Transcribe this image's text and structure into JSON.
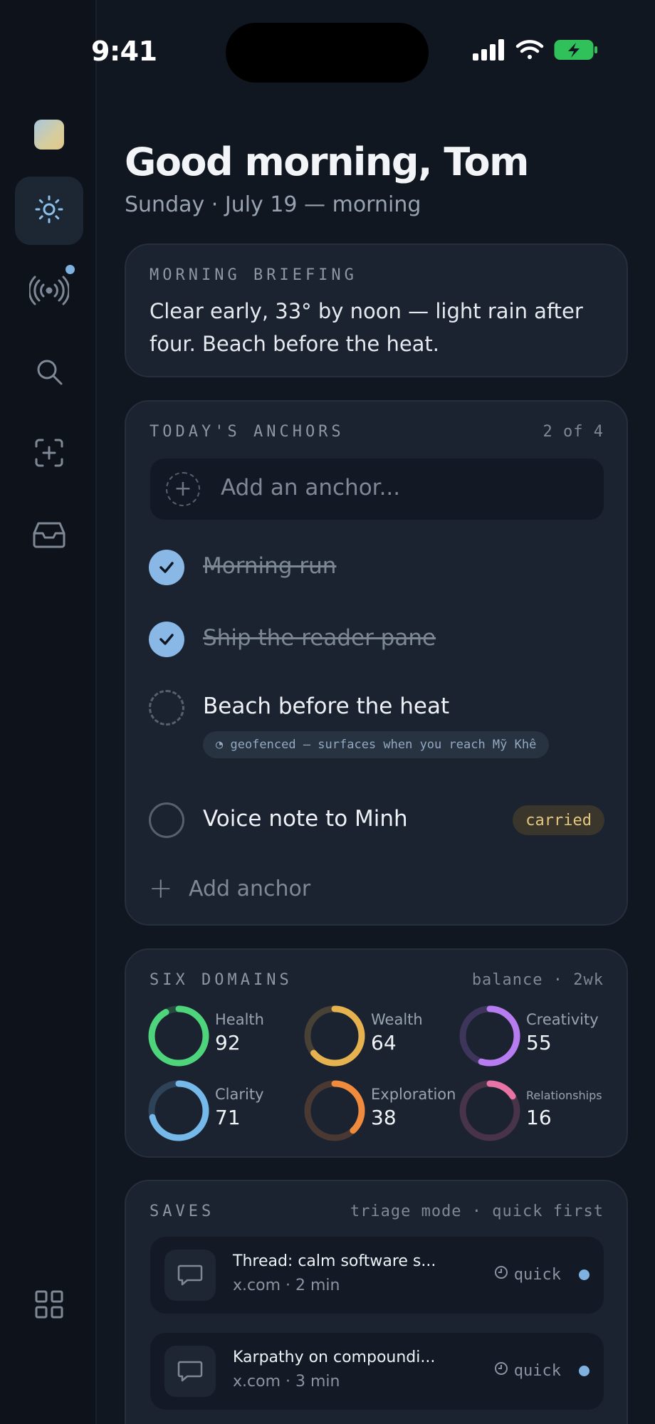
{
  "status": {
    "time": "9:41"
  },
  "header": {
    "greeting": "Good morning, Tom",
    "date": "Sunday · July 19 — morning"
  },
  "sidebar": {
    "items": [
      {
        "name": "today",
        "icon": "sun-icon",
        "active": true
      },
      {
        "name": "signals",
        "icon": "broadcast-icon",
        "badge": true
      },
      {
        "name": "search",
        "icon": "search-icon"
      },
      {
        "name": "capture",
        "icon": "add-frame-icon"
      },
      {
        "name": "inbox",
        "icon": "inbox-icon"
      },
      {
        "name": "apps",
        "icon": "grid-icon"
      }
    ]
  },
  "briefing": {
    "label": "MORNING BRIEFING",
    "text": "Clear early, 33° by noon — light rain after four. Beach before the heat."
  },
  "anchors": {
    "label": "TODAY'S ANCHORS",
    "count": "2 of 4",
    "input_placeholder": "Add an anchor...",
    "items": [
      {
        "text": "Morning run",
        "state": "done"
      },
      {
        "text": "Ship the reader pane",
        "state": "done"
      },
      {
        "text": "Beach before the heat",
        "state": "pending",
        "tag": "◔ geofenced — surfaces when you reach Mỹ Khê"
      },
      {
        "text": "Voice note to Minh",
        "state": "open",
        "badge": "carried"
      }
    ],
    "add_label": "Add anchor"
  },
  "domains": {
    "label": "SIX DOMAINS",
    "meta": "balance · 2wk",
    "items": [
      {
        "name": "Health",
        "value": 92,
        "color": "#4ed47a"
      },
      {
        "name": "Wealth",
        "value": 64,
        "color": "#e5b24f"
      },
      {
        "name": "Creativity",
        "value": 55,
        "color": "#b77cf0"
      },
      {
        "name": "Clarity",
        "value": 71,
        "color": "#74b9ea"
      },
      {
        "name": "Exploration",
        "value": 38,
        "color": "#f08a3c"
      },
      {
        "name": "Relationships",
        "value": 16,
        "color": "#e874a6"
      }
    ]
  },
  "saves": {
    "label": "SAVES",
    "meta": "triage mode · quick first",
    "items": [
      {
        "title": "Thread: calm software s...",
        "source": "x.com · 2 min",
        "tag": "quick"
      },
      {
        "title": "Karpathy on compoundi...",
        "source": "x.com · 3 min",
        "tag": "quick"
      }
    ]
  }
}
